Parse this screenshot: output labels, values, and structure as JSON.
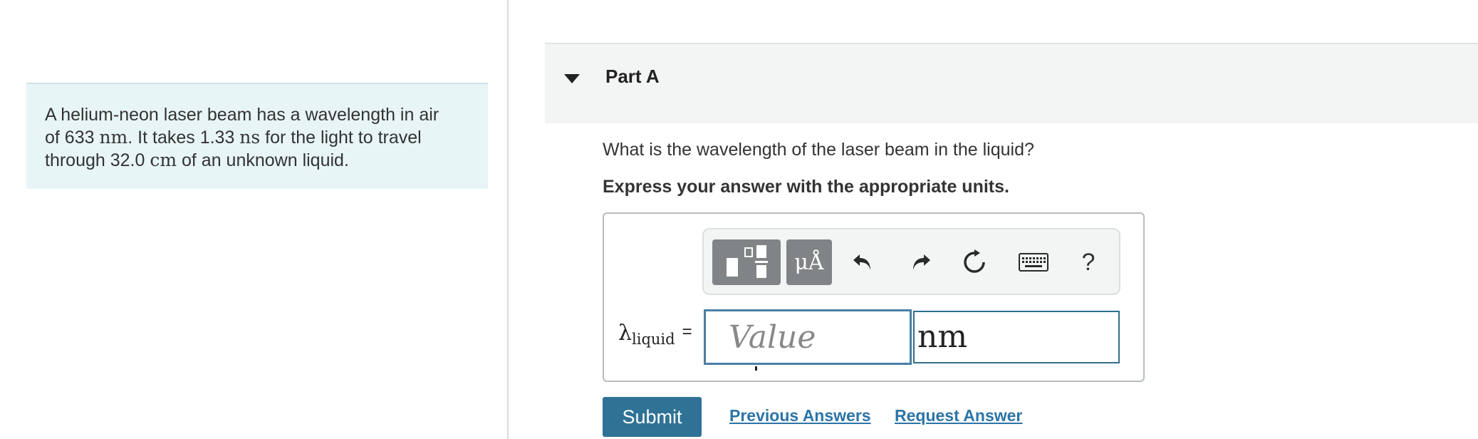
{
  "problem": {
    "part1": "A helium-neon laser beam has a wavelength in air",
    "part2_prefix": "of 633 ",
    "unit_nm": "nm",
    "part2_mid": ". It takes 1.33 ",
    "unit_ns": "ns",
    "part2_suffix": " for the light to travel",
    "part3_prefix": "through 32.0 ",
    "unit_cm": "cm",
    "part3_suffix": " of an unknown liquid."
  },
  "part": {
    "title": "Part A",
    "question": "What is the wavelength of the laser beam in the liquid?",
    "instruction": "Express your answer with the appropriate units."
  },
  "toolbar": {
    "units_label": "μÅ",
    "help_label": "?"
  },
  "answer": {
    "symbol": "λ",
    "subscript": "liquid",
    "equals": "=",
    "value_placeholder": "Value",
    "unit_value": "nm"
  },
  "actions": {
    "submit_label": "Submit",
    "previous_answers": "Previous Answers",
    "request_answer": "Request Answer"
  },
  "colors": {
    "problem_bg": "#e8f5f7",
    "submit_bg": "#2f7296",
    "link": "#2b74a8",
    "input_border": "#4a7fa5"
  }
}
